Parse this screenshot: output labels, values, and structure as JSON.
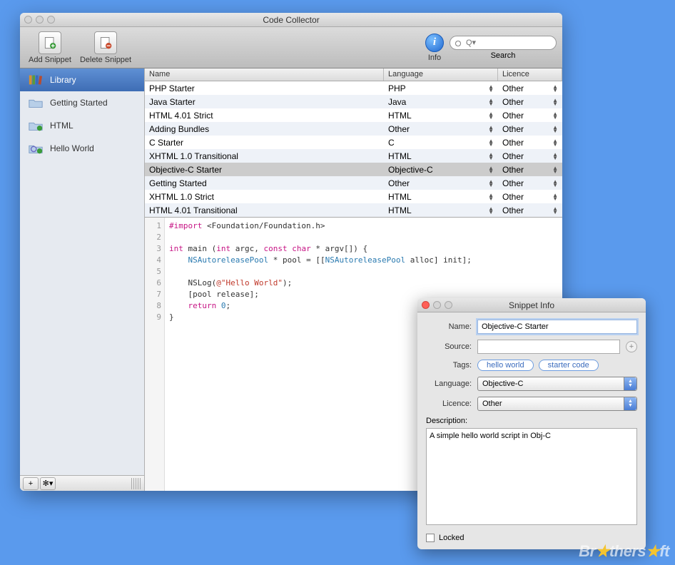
{
  "window": {
    "title": "Code Collector"
  },
  "toolbar": {
    "add_label": "Add Snippet",
    "delete_label": "Delete Snippet",
    "info_label": "Info",
    "search_label": "Search",
    "search_placeholder": "Q▾"
  },
  "sidebar": {
    "items": [
      {
        "label": "Library",
        "selected": true
      },
      {
        "label": "Getting Started"
      },
      {
        "label": "HTML"
      },
      {
        "label": "Hello World"
      }
    ]
  },
  "columns": {
    "name": "Name",
    "language": "Language",
    "licence": "Licence"
  },
  "rows": [
    {
      "name": "PHP Starter",
      "lang": "PHP",
      "lic": "Other"
    },
    {
      "name": "Java Starter",
      "lang": "Java",
      "lic": "Other"
    },
    {
      "name": "HTML 4.01 Strict",
      "lang": "HTML",
      "lic": "Other"
    },
    {
      "name": "Adding Bundles",
      "lang": "Other",
      "lic": "Other"
    },
    {
      "name": "C Starter",
      "lang": "C",
      "lic": "Other"
    },
    {
      "name": "XHTML 1.0 Transitional",
      "lang": "HTML",
      "lic": "Other"
    },
    {
      "name": "Objective-C Starter",
      "lang": "Objective-C",
      "lic": "Other",
      "selected": true
    },
    {
      "name": "Getting Started",
      "lang": "Other",
      "lic": "Other"
    },
    {
      "name": "XHTML 1.0 Strict",
      "lang": "HTML",
      "lic": "Other"
    },
    {
      "name": "HTML 4.01 Transitional",
      "lang": "HTML",
      "lic": "Other"
    }
  ],
  "code": {
    "lines": [
      "1",
      "2",
      "3",
      "4",
      "5",
      "6",
      "7",
      "8",
      "9"
    ],
    "l1_a": "#import",
    "l1_b": " <Foundation/Foundation.h>",
    "l3_a": "int",
    "l3_b": " main (",
    "l3_c": "int",
    "l3_d": " argc, ",
    "l3_e": "const char",
    "l3_f": " * argv[]) {",
    "l4_a": "    ",
    "l4_b": "NSAutoreleasePool",
    "l4_c": " * pool = [[",
    "l4_d": "NSAutoreleasePool",
    "l4_e": " alloc] init];",
    "l6_a": "    NSLog(",
    "l6_b": "@\"Hello World\"",
    "l6_c": ");",
    "l7": "    [pool release];",
    "l8_a": "    ",
    "l8_b": "return",
    "l8_c": " ",
    "l8_d": "0",
    "l8_e": ";",
    "l9": "}"
  },
  "panel": {
    "title": "Snippet Info",
    "labels": {
      "name": "Name:",
      "source": "Source:",
      "tags": "Tags:",
      "language": "Language:",
      "licence": "Licence:",
      "description": "Description:",
      "locked": "Locked"
    },
    "values": {
      "name": "Objective-C Starter",
      "source": "",
      "language": "Objective-C",
      "licence": "Other",
      "description": "A simple hello world script in Obj-C"
    },
    "tags": [
      "hello world",
      "starter code"
    ]
  },
  "watermark": {
    "a": "Br",
    "b": "thers",
    "c": "ft"
  }
}
